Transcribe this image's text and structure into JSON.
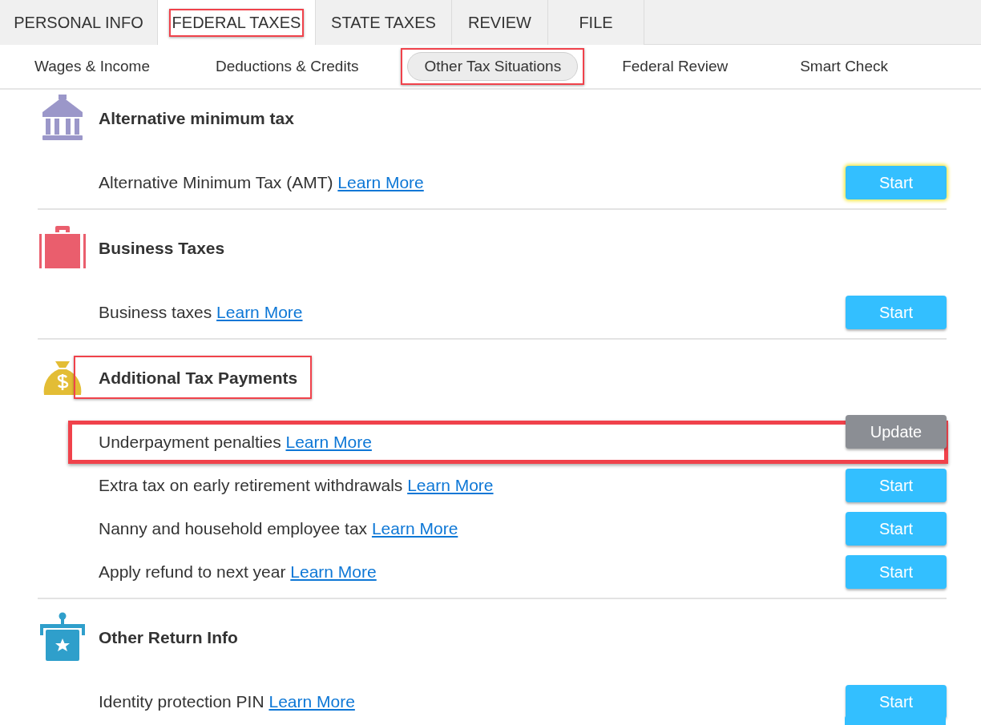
{
  "main_tabs": [
    {
      "label": "PERSONAL INFO",
      "selected": false,
      "highlighted": false
    },
    {
      "label": "FEDERAL TAXES",
      "selected": true,
      "highlighted": true
    },
    {
      "label": "STATE TAXES",
      "selected": false,
      "highlighted": false
    },
    {
      "label": "REVIEW",
      "selected": false,
      "highlighted": false
    },
    {
      "label": "FILE",
      "selected": false,
      "highlighted": false
    }
  ],
  "sub_tabs": [
    {
      "label": "Wages & Income",
      "selected": false,
      "highlighted": false
    },
    {
      "label": "Deductions & Credits",
      "selected": false,
      "highlighted": false
    },
    {
      "label": "Other Tax Situations",
      "selected": true,
      "highlighted": true
    },
    {
      "label": "Federal Review",
      "selected": false,
      "highlighted": false
    },
    {
      "label": "Smart Check",
      "selected": false,
      "highlighted": false
    }
  ],
  "sections": [
    {
      "kind": "bank",
      "title": "Alternative minimum tax",
      "highlighted": false,
      "rows": [
        {
          "label": "Alternative Minimum Tax (AMT)",
          "link": "Learn More",
          "button": "Start",
          "started": false,
          "focused": true,
          "highlighted": false
        }
      ]
    },
    {
      "kind": "briefcase",
      "title": "Business Taxes",
      "highlighted": false,
      "rows": [
        {
          "label": "Business taxes",
          "link": "Learn More",
          "button": "Start",
          "started": false,
          "focused": false,
          "highlighted": false
        }
      ]
    },
    {
      "kind": "moneybag",
      "title": "Additional Tax Payments",
      "highlighted": true,
      "rows": [
        {
          "label": "Underpayment penalties",
          "link": "Learn More",
          "button": "Update",
          "started": true,
          "focused": false,
          "highlighted": true
        },
        {
          "label": "Extra tax on early retirement withdrawals",
          "link": "Learn More",
          "button": "Start",
          "started": false,
          "focused": false,
          "highlighted": false
        },
        {
          "label": "Nanny and household employee tax",
          "link": "Learn More",
          "button": "Start",
          "started": false,
          "focused": false,
          "highlighted": false
        },
        {
          "label": "Apply refund to next year",
          "link": "Learn More",
          "button": "Start",
          "started": false,
          "focused": false,
          "highlighted": false
        }
      ]
    },
    {
      "kind": "podium",
      "title": "Other Return Info",
      "highlighted": false,
      "rows": [
        {
          "label": "Identity protection PIN",
          "link": "Learn More",
          "button": "Start",
          "started": false,
          "focused": false,
          "highlighted": false
        }
      ]
    }
  ]
}
